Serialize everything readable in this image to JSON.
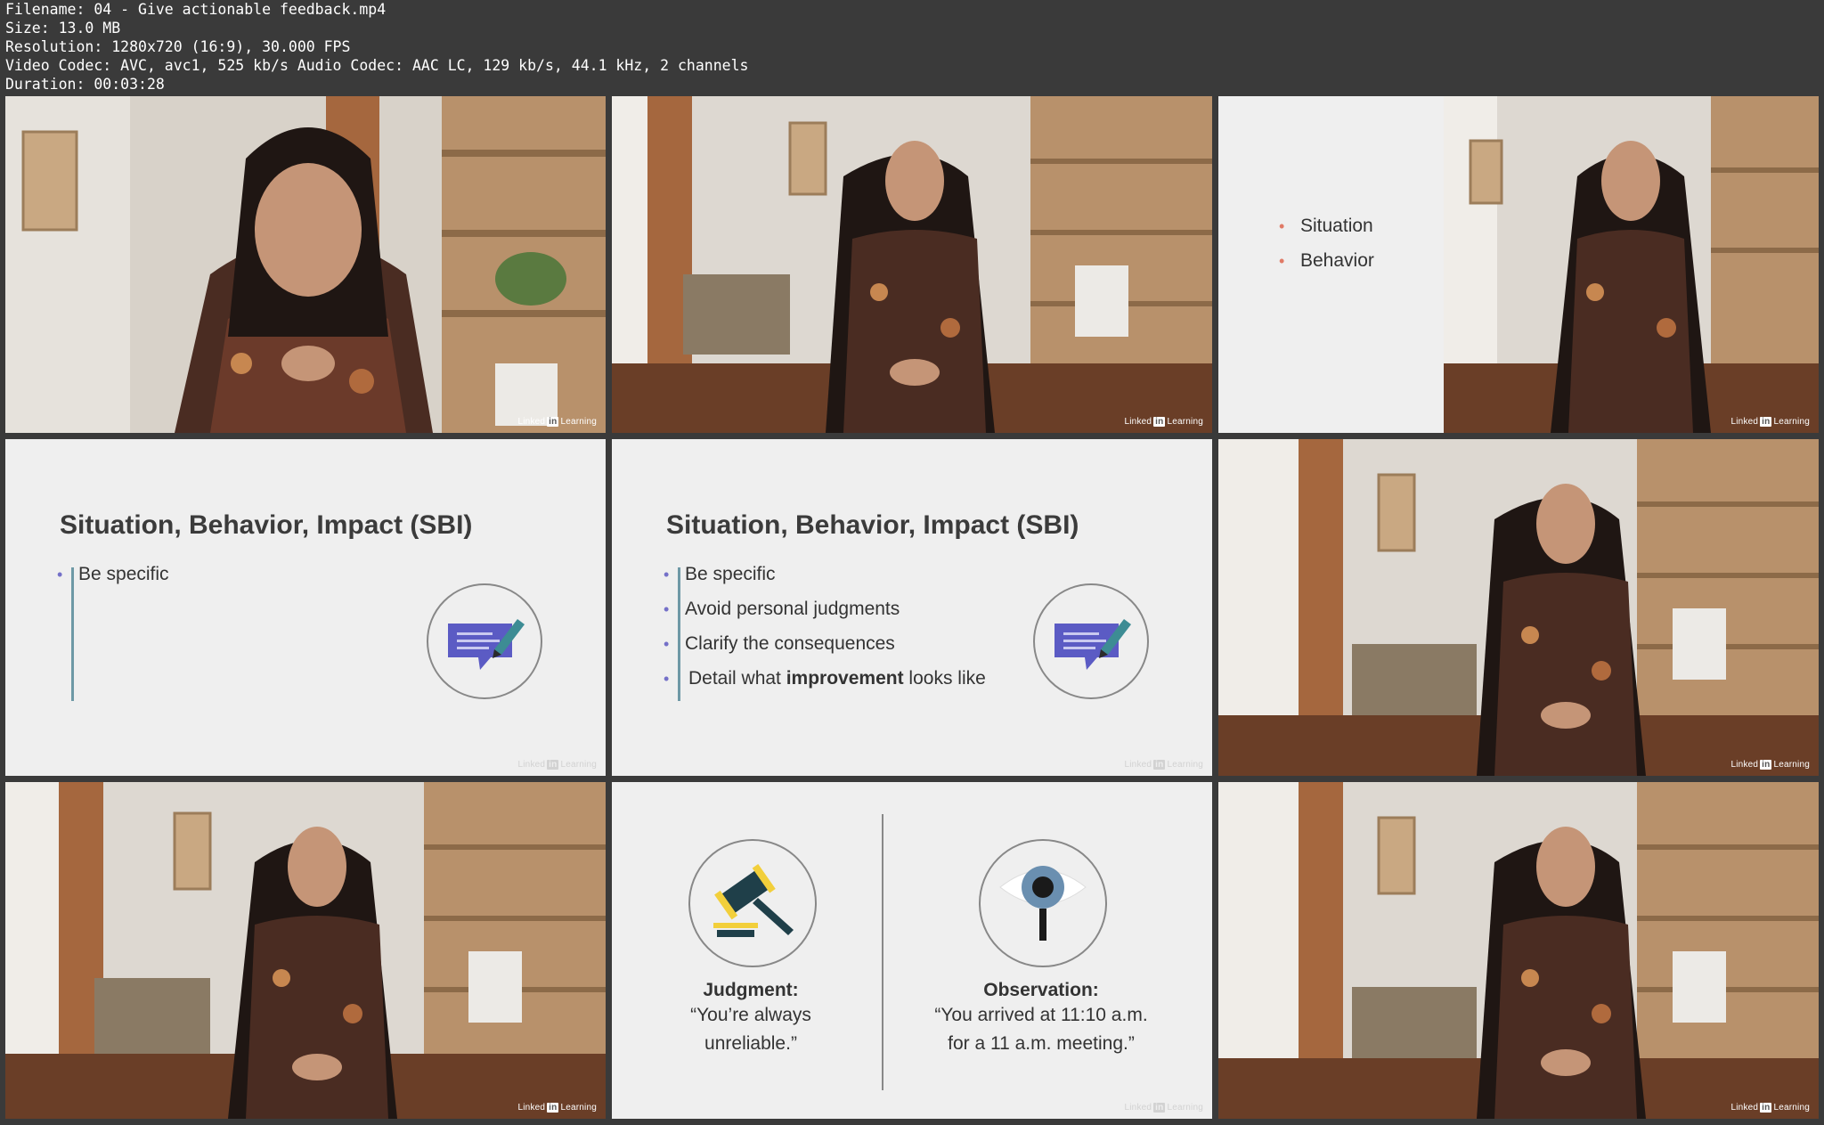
{
  "file_info": {
    "filename": "Filename: 04 - Give actionable feedback.mp4",
    "size": "Size: 13.0 MB",
    "resolution": "Resolution: 1280x720 (16:9), 30.000 FPS",
    "codec": "Video Codec: AVC, avc1, 525 kb/s Audio Codec: AAC LC, 129 kb/s, 44.1 kHz, 2 channels",
    "duration": "Duration: 00:03:28"
  },
  "watermark": {
    "brand_pre": "Linked",
    "brand_in": "in",
    "brand_post": "Learning"
  },
  "tile3": {
    "bullets": [
      "Situation",
      "Behavior"
    ]
  },
  "tile4": {
    "title": "Situation, Behavior, Impact (SBI)",
    "bullets": [
      "Be specific"
    ]
  },
  "tile5": {
    "title": "Situation, Behavior, Impact (SBI)",
    "bullets": [
      "Be specific",
      "Avoid personal judgments",
      "Clarify the consequences"
    ],
    "last_pre": "Detail what ",
    "last_bold": "improvement",
    "last_post": " looks like"
  },
  "tile8": {
    "judgment_label": "Judgment:",
    "judgment_quote_1": "“You’re always",
    "judgment_quote_2": "unreliable.”",
    "observation_label": "Observation:",
    "observation_quote_1": "“You arrived at 11:10 a.m.",
    "observation_quote_2": "for a 11 a.m. meeting.”"
  },
  "icons": {
    "feedback": "chat-pencil-icon",
    "judgment": "gavel-icon",
    "observation": "magnifier-eye-icon"
  },
  "colors": {
    "accent_purple": "#5b5bc4",
    "bullet_purple": "#7470c8",
    "bullet_coral": "#e07a66",
    "bar_teal": "#6e99a6",
    "background": "#3a3a3a"
  }
}
